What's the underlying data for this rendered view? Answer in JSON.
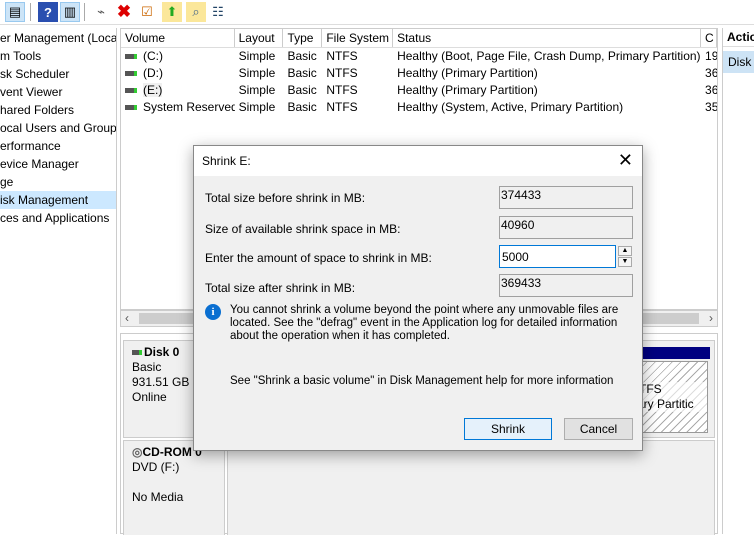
{
  "toolbar": {
    "icons": [
      "console-tree-icon",
      "help-icon",
      "action-pane-icon",
      "connect-drive-icon",
      "delete-icon",
      "properties-icon",
      "open-icon",
      "find-icon",
      "settings-list-icon"
    ]
  },
  "tree": {
    "items": [
      "er Management (Local",
      "m Tools",
      "sk Scheduler",
      "vent Viewer",
      "hared Folders",
      "ocal Users and Groups",
      "erformance",
      "evice Manager",
      "ge",
      "isk Management",
      "ces and Applications"
    ],
    "selected_index": 9
  },
  "volumes": {
    "columns": [
      "Volume",
      "Layout",
      "Type",
      "File System",
      "Status",
      "C"
    ],
    "rows": [
      [
        "(C:)",
        "Simple",
        "Basic",
        "NTFS",
        "Healthy (Boot, Page File, Crash Dump, Primary Partition)",
        "19"
      ],
      [
        "(D:)",
        "Simple",
        "Basic",
        "NTFS",
        "Healthy (Primary Partition)",
        "36"
      ],
      [
        "(E:)",
        "Simple",
        "Basic",
        "NTFS",
        "Healthy (Primary Partition)",
        "36"
      ],
      [
        "System Reserved",
        "Simple",
        "Basic",
        "NTFS",
        "Healthy (System, Active, Primary Partition)",
        "35"
      ]
    ]
  },
  "actions": {
    "header": "Actio",
    "item": "Disk"
  },
  "disks": [
    {
      "name": "Disk 0",
      "lines": [
        "Basic",
        "931.51 GB",
        "Online"
      ],
      "partition_text": [
        "TFS",
        "mary Partitic"
      ]
    },
    {
      "name": "CD-ROM 0",
      "lines": [
        "DVD (F:)",
        "",
        "No Media"
      ]
    }
  ],
  "dialog": {
    "title": "Shrink E:",
    "fields": [
      {
        "label": "Total size before shrink in MB:",
        "value": "374433"
      },
      {
        "label": "Size of available shrink space in MB:",
        "value": "40960"
      },
      {
        "label": "Enter the amount of space to shrink in MB:",
        "value": "5000"
      },
      {
        "label": "Total size after shrink in MB:",
        "value": "369433"
      }
    ],
    "info": "You cannot shrink a volume beyond the point where any unmovable files are located. See the \"defrag\" event in the Application log for detailed information about the operation when it has completed.",
    "help": "See \"Shrink a basic volume\" in Disk Management help for more information",
    "shrink_label": "Shrink",
    "cancel_label": "Cancel"
  },
  "colors": {
    "accent": "#0078d7",
    "selection": "#cce8ff",
    "partition_bar": "#000080"
  }
}
